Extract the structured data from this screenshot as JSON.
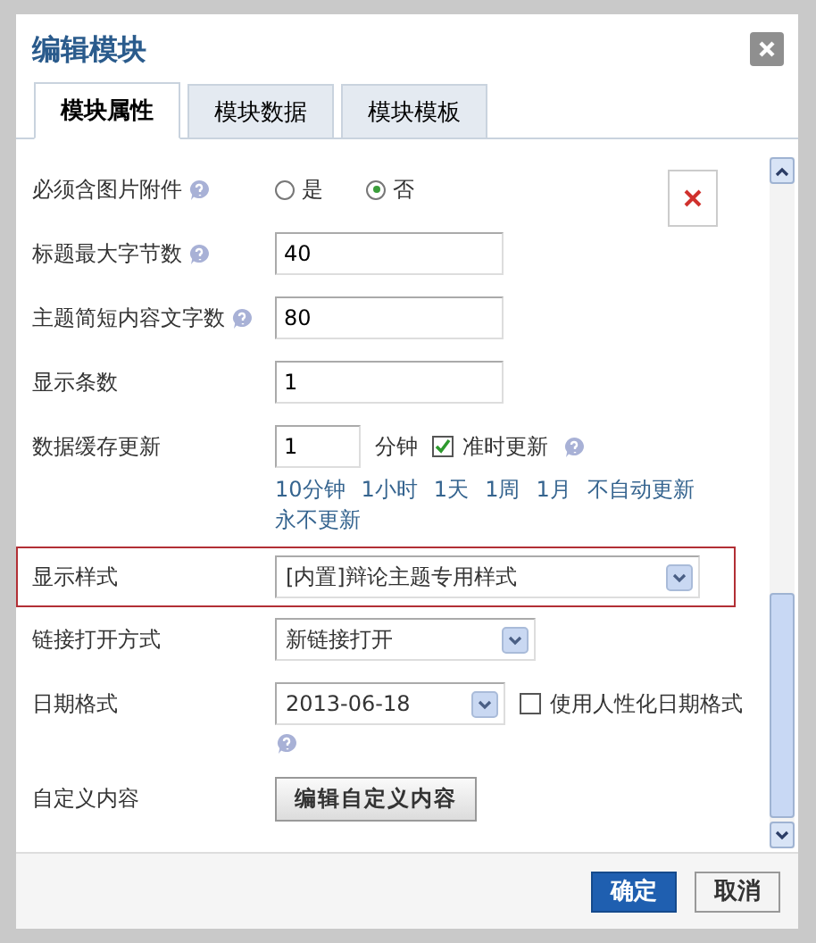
{
  "window": {
    "title": "编辑模块"
  },
  "tabs": [
    {
      "label": "模块属性",
      "selected": true
    },
    {
      "label": "模块数据",
      "selected": false
    },
    {
      "label": "模块模板",
      "selected": false
    }
  ],
  "fields": [
    {
      "kind": "radio",
      "label": "必须含图片附件",
      "help": true,
      "options": [
        {
          "label": "是",
          "selected": false
        },
        {
          "label": "否",
          "selected": true
        }
      ]
    },
    {
      "kind": "text",
      "label": "标题最大字节数",
      "help": true,
      "value": "40"
    },
    {
      "kind": "text",
      "label": "主题简短内容文字数",
      "help": true,
      "value": "80"
    },
    {
      "kind": "text",
      "label": "显示条数",
      "help": false,
      "value": "1"
    },
    {
      "kind": "cache",
      "label": "数据缓存更新",
      "value": "1",
      "unit": "分钟",
      "checkbox": {
        "label": "准时更新",
        "checked": true
      },
      "help": true,
      "links": [
        "10分钟",
        "1小时",
        "1天",
        "1周",
        "1月",
        "不自动更新",
        "永不更新"
      ]
    },
    {
      "kind": "select",
      "label": "显示样式",
      "value": "[内置]辩论主题专用样式",
      "highlighted": true
    },
    {
      "kind": "select",
      "label": "链接打开方式",
      "value": "新链接打开",
      "highlighted": false
    },
    {
      "kind": "date",
      "label": "日期格式",
      "value": "2013-06-18",
      "checkbox": {
        "label": "使用人性化日期格式",
        "checked": false
      },
      "help": true
    },
    {
      "kind": "button",
      "label": "自定义内容",
      "button": "编辑自定义内容"
    }
  ],
  "buttons": [
    {
      "label": "确定",
      "primary": true
    },
    {
      "label": "取消",
      "primary": false
    }
  ]
}
